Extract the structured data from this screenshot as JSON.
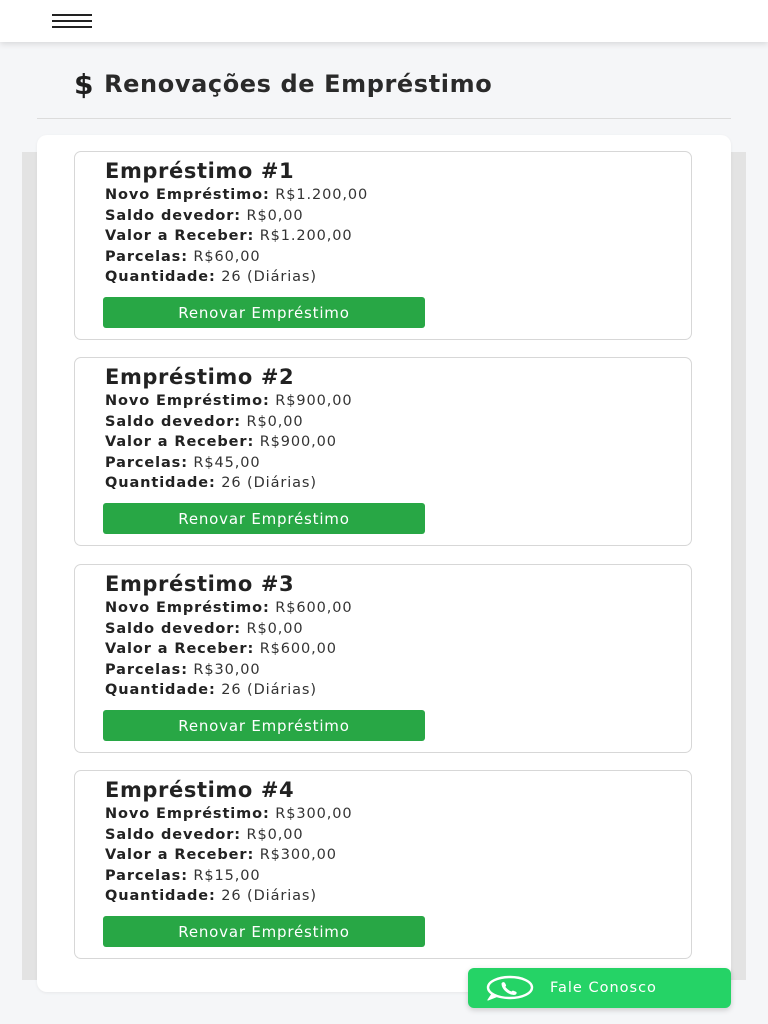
{
  "header": {
    "menu_icon": "hamburger-icon"
  },
  "page": {
    "title_icon": "dollar-icon",
    "title_symbol": "$",
    "title": "Renovações de Empréstimo"
  },
  "loans": [
    {
      "title": "Empréstimo #1",
      "novo_label": "Novo Empréstimo:",
      "novo_value": "R$1.200,00",
      "saldo_label": "Saldo devedor:",
      "saldo_value": "R$0,00",
      "valor_label": "Valor a Receber:",
      "valor_value": "R$1.200,00",
      "parcelas_label": "Parcelas:",
      "parcelas_value": "R$60,00",
      "quantidade_label": "Quantidade:",
      "quantidade_value": "26 (Diárias)",
      "button_label": "Renovar Empréstimo"
    },
    {
      "title": "Empréstimo #2",
      "novo_label": "Novo Empréstimo:",
      "novo_value": "R$900,00",
      "saldo_label": "Saldo devedor:",
      "saldo_value": "R$0,00",
      "valor_label": "Valor a Receber:",
      "valor_value": "R$900,00",
      "parcelas_label": "Parcelas:",
      "parcelas_value": "R$45,00",
      "quantidade_label": "Quantidade:",
      "quantidade_value": "26 (Diárias)",
      "button_label": "Renovar Empréstimo"
    },
    {
      "title": "Empréstimo #3",
      "novo_label": "Novo Empréstimo:",
      "novo_value": "R$600,00",
      "saldo_label": "Saldo devedor:",
      "saldo_value": "R$0,00",
      "valor_label": "Valor a Receber:",
      "valor_value": "R$600,00",
      "parcelas_label": "Parcelas:",
      "parcelas_value": "R$30,00",
      "quantidade_label": "Quantidade:",
      "quantidade_value": "26 (Diárias)",
      "button_label": "Renovar Empréstimo"
    },
    {
      "title": "Empréstimo #4",
      "novo_label": "Novo Empréstimo:",
      "novo_value": "R$300,00",
      "saldo_label": "Saldo devedor:",
      "saldo_value": "R$0,00",
      "valor_label": "Valor a Receber:",
      "valor_value": "R$300,00",
      "parcelas_label": "Parcelas:",
      "parcelas_value": "R$15,00",
      "quantidade_label": "Quantidade:",
      "quantidade_value": "26 (Diárias)",
      "button_label": "Renovar Empréstimo"
    }
  ],
  "whatsapp": {
    "icon": "whatsapp-icon",
    "label": "Fale Conosco"
  },
  "colors": {
    "accent_green": "#28a745",
    "whatsapp_green": "#25d366",
    "background": "#f5f6f8"
  }
}
